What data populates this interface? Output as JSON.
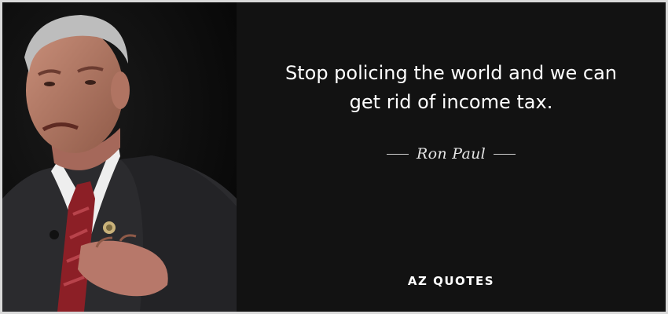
{
  "quote": {
    "lines": [
      "Stop policing the world and we can",
      "get rid of income tax."
    ]
  },
  "author": {
    "name": "Ron Paul"
  },
  "brand": {
    "name": "AZ QUOTES"
  },
  "colors": {
    "background": "#121212",
    "text": "#ffffff",
    "frame": "#d9d9d9"
  },
  "photo": {
    "description_icon": "speaker-portrait"
  }
}
